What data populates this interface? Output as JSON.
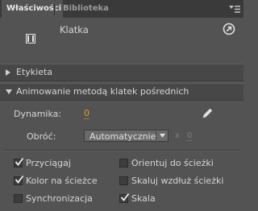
{
  "tabs": [
    {
      "label": "Właściwości",
      "active": true
    },
    {
      "label": "Biblioteka",
      "active": false
    }
  ],
  "header": {
    "title": "Klatka"
  },
  "sections": {
    "label_section": {
      "title": "Etykieta",
      "expanded": false
    },
    "tween_section": {
      "title": "Animowanie metodą klatek pośrednich",
      "expanded": true
    }
  },
  "tween": {
    "easing_label": "Dynamika:",
    "easing_value": "0",
    "rotate_label": "Obróć:",
    "rotate_value": "Automatycznie",
    "times_symbol": "x",
    "rotate_count": "0"
  },
  "options": [
    {
      "label": "Przyciągaj",
      "checked": true
    },
    {
      "label": "Orientuj do ścieżki",
      "checked": false
    },
    {
      "label": "Kolor na ścieżce",
      "checked": true
    },
    {
      "label": "Skaluj wzdłuż ścieżki",
      "checked": false
    },
    {
      "label": "Synchronizacja",
      "checked": false
    },
    {
      "label": "Skala",
      "checked": true
    }
  ],
  "colors": {
    "panel_bg": "#535353",
    "tab_bar_bg": "#3a3a3a",
    "section_bg": "#474747",
    "hot_text": "#e09b28"
  },
  "icons": {
    "panel_menu": "panel-menu-icon",
    "frame": "frame-icon",
    "goto": "go-to-frame-icon",
    "edit_easing": "pencil-icon"
  }
}
